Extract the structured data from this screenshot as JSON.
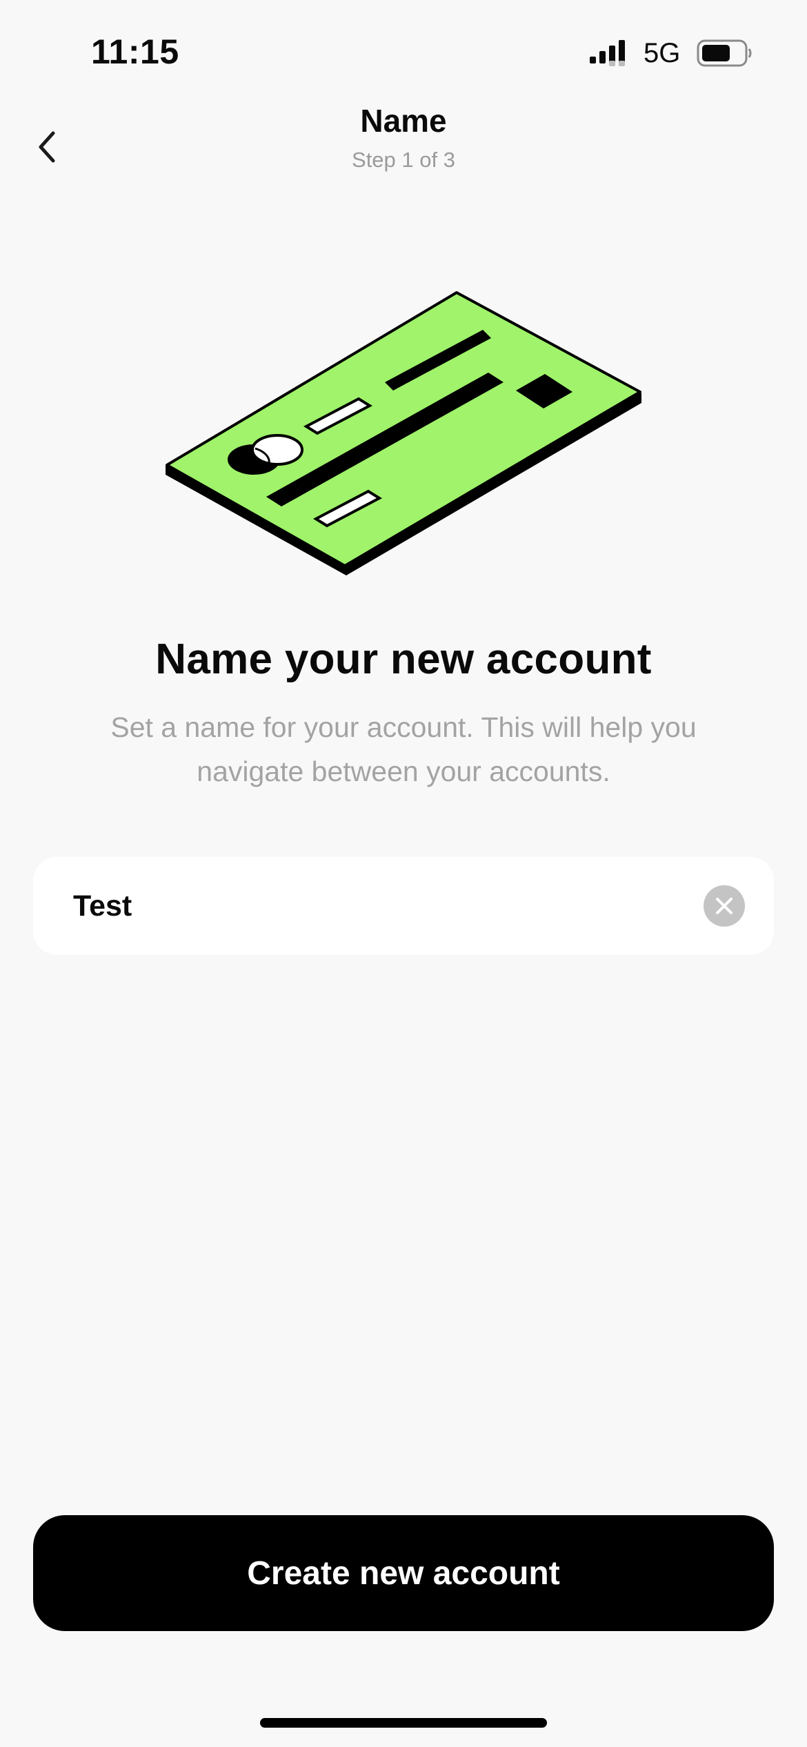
{
  "status_bar": {
    "time": "11:15",
    "network": "5G",
    "signal_icon": "signal-bars-icon",
    "battery_icon": "battery-icon"
  },
  "header": {
    "title": "Name",
    "subtitle": "Step 1 of 3",
    "back_icon": "chevron-left-icon"
  },
  "illustration": {
    "name": "credit-card-illustration",
    "card_color": "#a0f36a"
  },
  "content": {
    "heading": "Name your new account",
    "description": "Set a name for your account. This will help you navigate between your accounts."
  },
  "name_field": {
    "value": "Test",
    "clear_icon": "close-icon"
  },
  "actions": {
    "create_label": "Create new account"
  },
  "colors": {
    "background": "#f8f8f8",
    "accent": "#a0f36a",
    "button": "#000000",
    "muted_text": "#a3a3a3"
  }
}
